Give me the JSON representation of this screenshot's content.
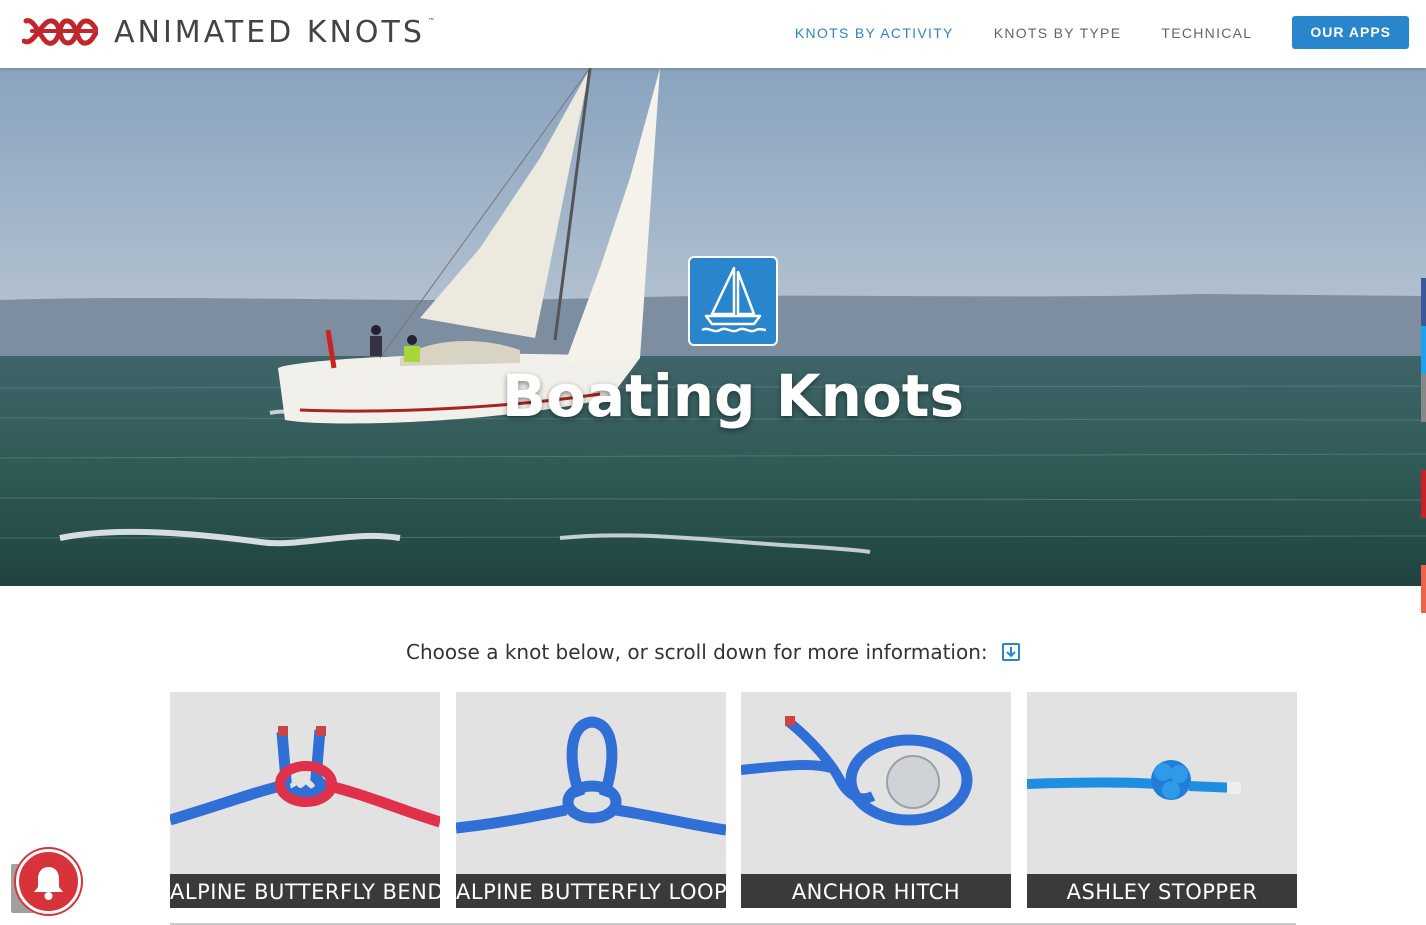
{
  "header": {
    "brand": "ANIMATED KNOTS",
    "trademark": "™",
    "nav": [
      {
        "label": "KNOTS BY ACTIVITY",
        "active": true
      },
      {
        "label": "KNOTS BY TYPE",
        "active": false
      },
      {
        "label": "TECHNICAL",
        "active": false
      }
    ],
    "apps_button": "OUR APPS"
  },
  "hero": {
    "title": "Boating Knots",
    "icon": "sailboat-icon"
  },
  "intro": {
    "text": "Choose a knot below, or scroll down for more information:",
    "icon": "scroll-down-icon"
  },
  "knots": [
    {
      "label": "ALPINE BUTTERFLY BEND"
    },
    {
      "label": "ALPINE BUTTERFLY LOOP"
    },
    {
      "label": "ANCHOR HITCH"
    },
    {
      "label": "ASHLEY STOPPER"
    }
  ],
  "colors": {
    "accent": "#2a86cc",
    "brand_red": "#c0272d",
    "card_label_bg": "#3a3a3a",
    "card_bg": "#e2e2e2",
    "rope_blue": "#2f6fd6",
    "rope_red": "#e0304a"
  },
  "notification": {
    "icon": "bell-icon"
  }
}
